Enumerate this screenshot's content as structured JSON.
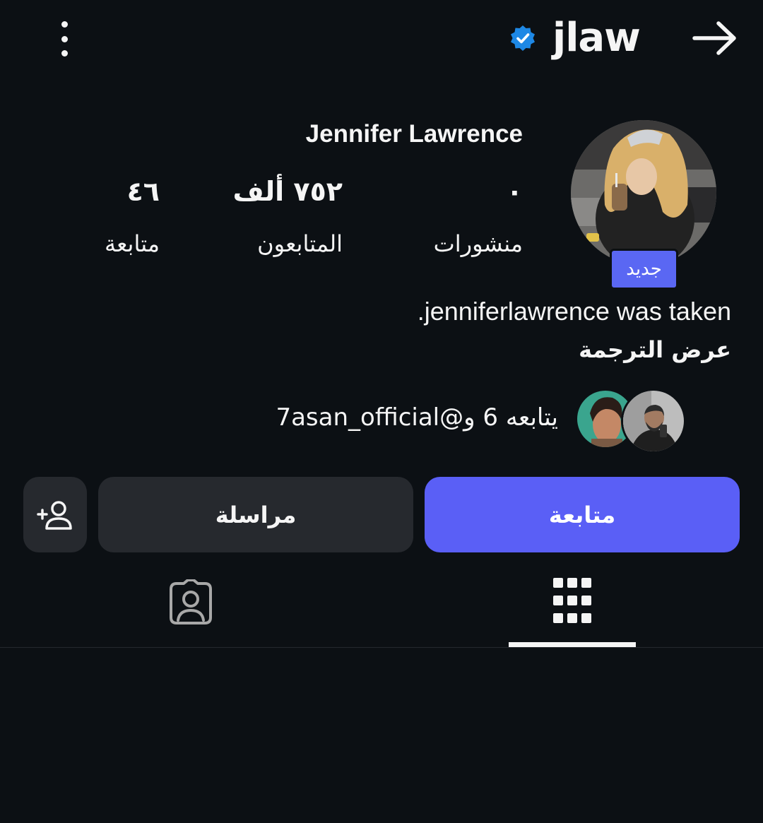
{
  "header": {
    "username": "jlaw",
    "verified_icon": "verified-badge-icon",
    "menu_icon": "more-vertical-icon",
    "back_icon": "arrow-right-icon"
  },
  "profile": {
    "display_name": "Jennifer Lawrence",
    "new_badge": "جديد",
    "stats": {
      "posts": {
        "value": "٠",
        "label": "منشورات"
      },
      "followers": {
        "value": "٧٥٢ ألف",
        "label": "المتابعون"
      },
      "following": {
        "value": "٤٦",
        "label": "متابعة"
      }
    },
    "bio": ".jenniferlawrence was taken",
    "translate_label": "عرض الترجمة",
    "mutual_followers_text": "يتابعه 6 و@7asan_official"
  },
  "actions": {
    "follow_label": "متابعة",
    "message_label": "مراسلة",
    "suggest_icon": "add-person-icon"
  },
  "tabs": {
    "posts_icon": "grid-icon",
    "tagged_icon": "tagged-person-icon",
    "active": "posts"
  },
  "colors": {
    "background": "#0c1014",
    "primary_button": "#5a5ff6",
    "secondary_button": "#26292e",
    "verified": "#1e88e5",
    "badge": "#5a67f3"
  }
}
